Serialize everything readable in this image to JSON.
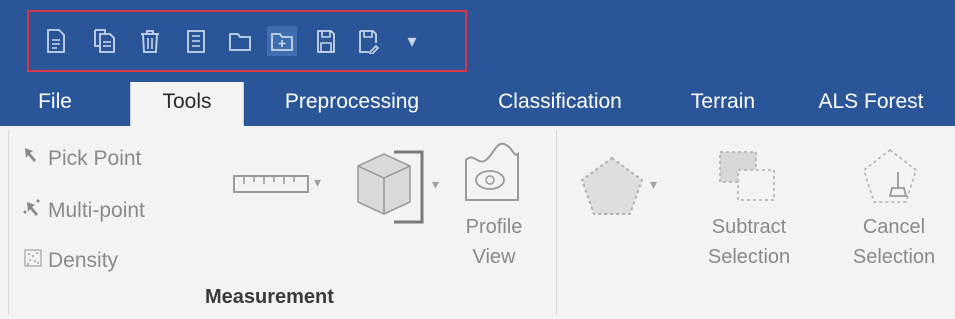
{
  "quick_access": {
    "icons": [
      "new-file-icon",
      "copy-file-icon",
      "delete-icon",
      "document-list-icon",
      "folder-icon",
      "folder-add-icon",
      "save-icon",
      "save-as-icon",
      "customize-dropdown-icon"
    ],
    "dropdown_glyph": "▾"
  },
  "tabs": [
    {
      "label": "File",
      "active": false
    },
    {
      "label": "Tools",
      "active": true
    },
    {
      "label": "Preprocessing",
      "active": false
    },
    {
      "label": "Classification",
      "active": false
    },
    {
      "label": "Terrain",
      "active": false
    },
    {
      "label": "ALS Forest",
      "active": false
    }
  ],
  "measurement_group": {
    "title": "Measurement",
    "small_buttons": [
      {
        "label": "Pick Point",
        "icon": "pick-point-icon"
      },
      {
        "label": "Multi-point",
        "icon": "multi-point-icon"
      },
      {
        "label": "Density",
        "icon": "density-icon"
      }
    ],
    "ruler_icon": "ruler-icon",
    "box_icon": "cube-measure-icon",
    "profile_view": {
      "line1": "Profile",
      "line2": "View",
      "icon": "profile-view-icon"
    }
  },
  "selection_group": {
    "polygon_icon": "polygon-select-icon",
    "subtract": {
      "line1": "Subtract",
      "line2": "Selection",
      "icon": "subtract-selection-icon"
    },
    "cancel": {
      "line1": "Cancel",
      "line2": "Selection",
      "icon": "cancel-selection-icon"
    }
  },
  "colors": {
    "title_bar": "#2a5699",
    "qat_highlight_border": "#d9364a",
    "ribbon_bg": "#f3f3f3",
    "disabled_text": "#8a8a8a"
  }
}
